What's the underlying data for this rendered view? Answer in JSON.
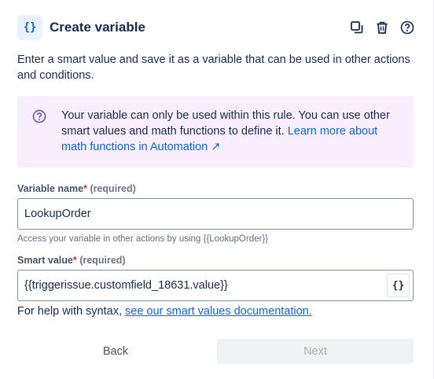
{
  "header": {
    "icon_glyph": "{}",
    "title": "Create variable",
    "actions": [
      "duplicate-icon",
      "trash-icon",
      "help-icon"
    ]
  },
  "description": "Enter a smart value and save it as a variable that can be used in other actions and conditions.",
  "info": {
    "icon": "question-circle-icon",
    "text": "Your variable can only be used within this rule. You can use other smart values and math functions to define it. ",
    "link_text": "Learn more about math functions in Automation",
    "link_arrow": "↗"
  },
  "variable_name": {
    "label": "Variable name",
    "required_marker": "*",
    "required_text": "(required)",
    "value": "LookupOrder",
    "helper": "Access your variable in other actions by using {{LookupOrder}}"
  },
  "smart_value": {
    "label": "Smart value",
    "required_marker": "*",
    "required_text": "(required)",
    "value": "{{triggerissue.customfield_18631.value}}",
    "button_glyph": "{}"
  },
  "syntax_help": {
    "text": "For help with syntax, ",
    "link_text": "see our smart values documentation."
  },
  "buttons": {
    "back": "Back",
    "next": "Next"
  },
  "colors": {
    "accent": "#0c66e4",
    "info_bg": "#f8eefe",
    "info_icon": "#6e5dc6",
    "required": "#c9372c"
  }
}
